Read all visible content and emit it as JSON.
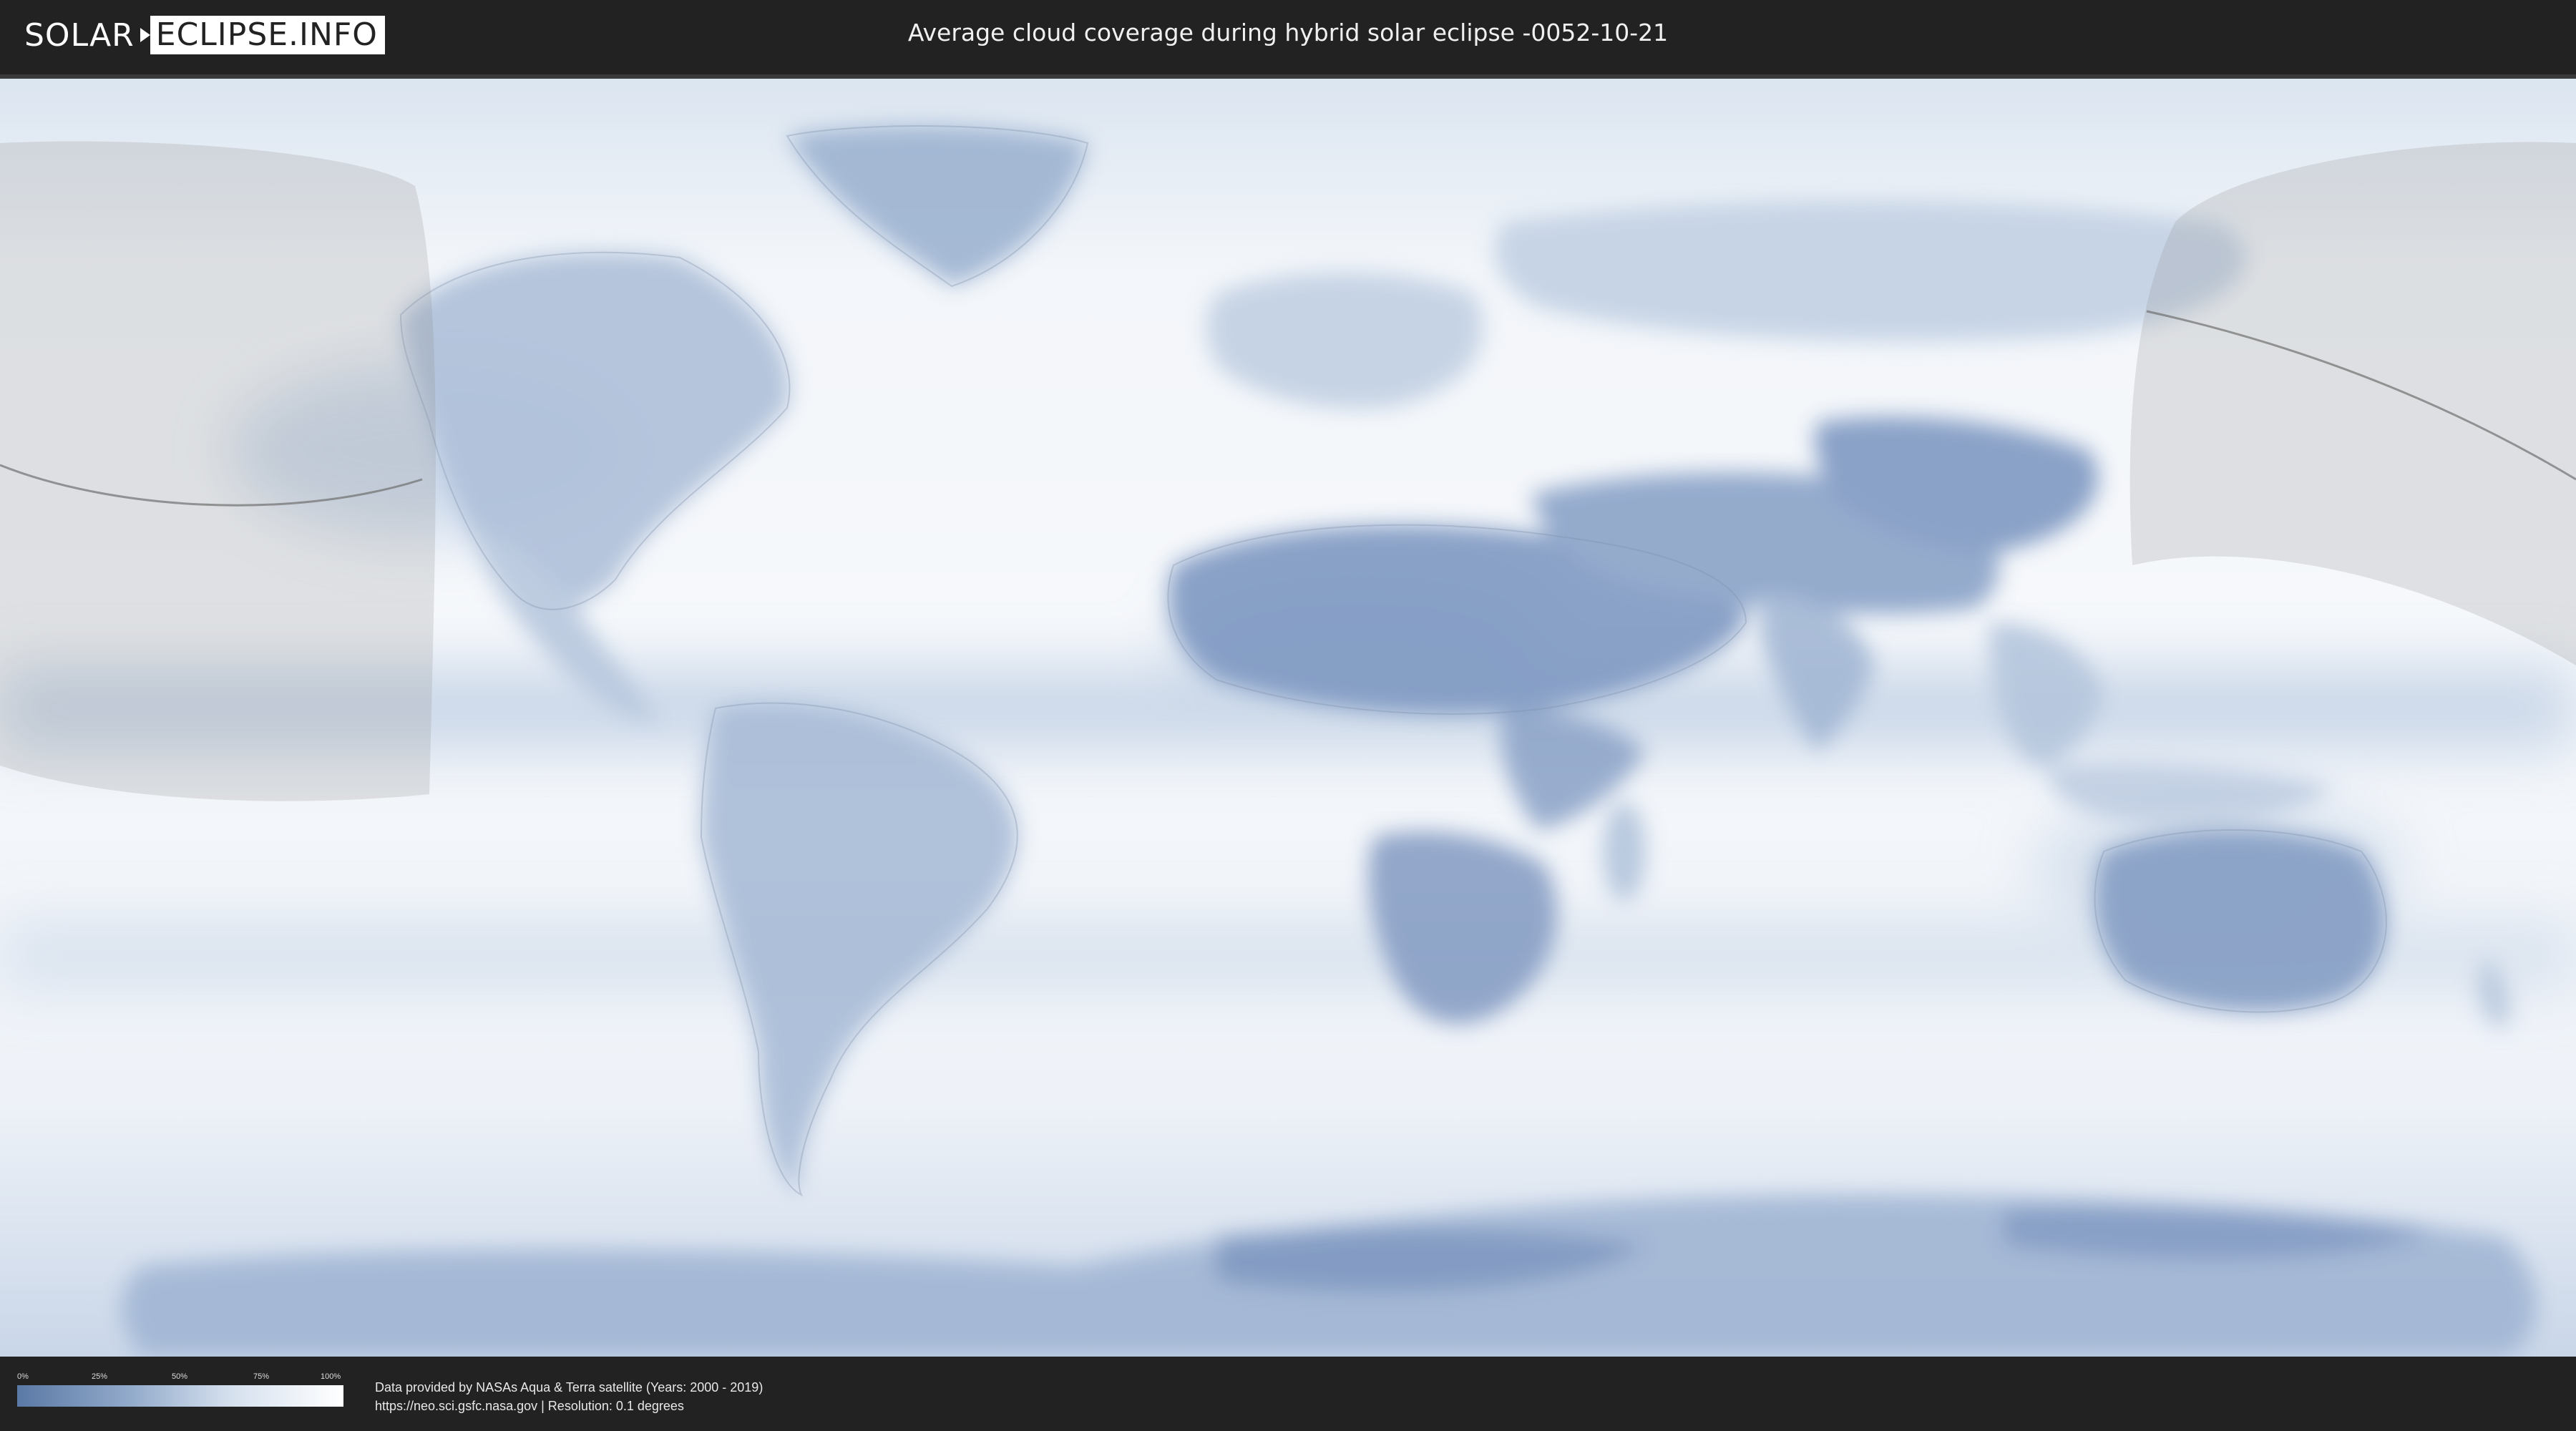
{
  "header": {
    "logo_solar": "SOLAR",
    "logo_info": "ECLIPSE.INFO",
    "title": "Average cloud coverage during hybrid solar eclipse -0052-10-21"
  },
  "legend": {
    "ticks": [
      "0%",
      "25%",
      "50%",
      "75%",
      "100%"
    ],
    "color_low": "#5b79a6",
    "color_high": "#ffffff"
  },
  "credits": {
    "line1": "Data provided by NASAs Aqua & Terra satellite (Years: 2000 - 2019)",
    "line2": "https://neo.sci.gsfc.nasa.gov | Resolution: 0.1 degrees"
  },
  "colors": {
    "background": "#222222",
    "map_light": "#f4f7fb",
    "map_cloud": "#7c97c0",
    "shadow": "#8c8c8c"
  },
  "icons": {
    "logo_mark": "eclipse-arrow-icon"
  }
}
